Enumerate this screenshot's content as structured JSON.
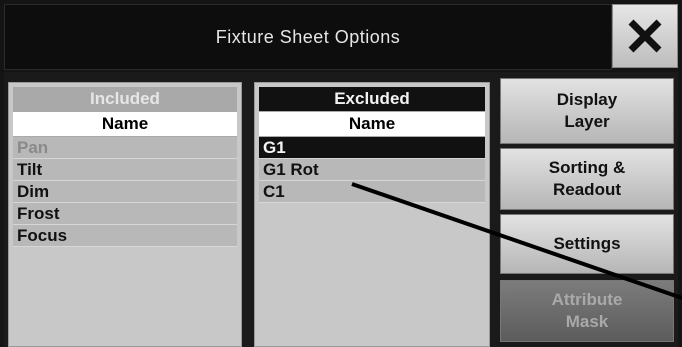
{
  "window": {
    "title": "Fixture Sheet Options",
    "close_icon": "close-icon"
  },
  "included": {
    "header": "Included",
    "column": "Name",
    "rows": [
      "Pan",
      "Tilt",
      "Dim",
      "Frost",
      "Focus"
    ]
  },
  "excluded": {
    "header": "Excluded",
    "column": "Name",
    "rows": [
      "G1",
      "G1 Rot",
      "C1"
    ],
    "selected": "G1"
  },
  "buttons": {
    "display_layer": [
      "Display",
      "Layer"
    ],
    "sorting_readout": [
      "Sorting &",
      "Readout"
    ],
    "settings": "Settings",
    "attribute_mask": [
      "Attribute",
      "Mask"
    ]
  },
  "colors": {
    "selected_row": "#111111",
    "button_face": "#d0d0d0",
    "disabled_button": "#6a6a6a"
  }
}
